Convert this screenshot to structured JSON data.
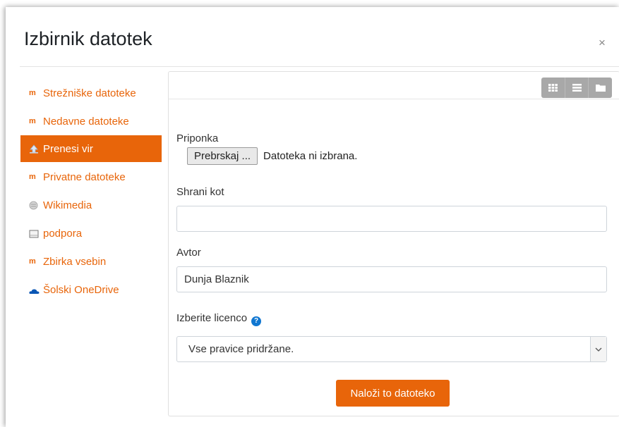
{
  "dialog": {
    "title": "Izbirnik datotek",
    "close_label": "×"
  },
  "sidebar": {
    "items": [
      {
        "label": "Strežniške datoteke",
        "icon": "moodle-icon"
      },
      {
        "label": "Nedavne datoteke",
        "icon": "moodle-icon"
      },
      {
        "label": "Prenesi vir",
        "icon": "upload-icon",
        "active": true
      },
      {
        "label": "Privatne datoteke",
        "icon": "moodle-icon"
      },
      {
        "label": "Wikimedia",
        "icon": "wikimedia-icon"
      },
      {
        "label": "podpora",
        "icon": "folder-box-icon"
      },
      {
        "label": "Zbirka vsebin",
        "icon": "moodle-icon"
      },
      {
        "label": "Šolski OneDrive",
        "icon": "onedrive-icon"
      }
    ]
  },
  "toolbar": {
    "views": [
      "grid-view-icon",
      "list-view-icon",
      "folder-view-icon"
    ]
  },
  "form": {
    "attachment_label": "Priponka",
    "browse_label": "Prebrskaj ...",
    "file_status": "Datoteka ni izbrana.",
    "save_as_label": "Shrani kot",
    "save_as_value": "",
    "author_label": "Avtor",
    "author_value": "Dunja Blaznik",
    "license_label": "Izberite licenco",
    "license_value": "Vse pravice pridržane.",
    "upload_label": "Naloži to datoteko"
  },
  "colors": {
    "accent": "#e8650a",
    "help_icon": "#1177d1"
  }
}
